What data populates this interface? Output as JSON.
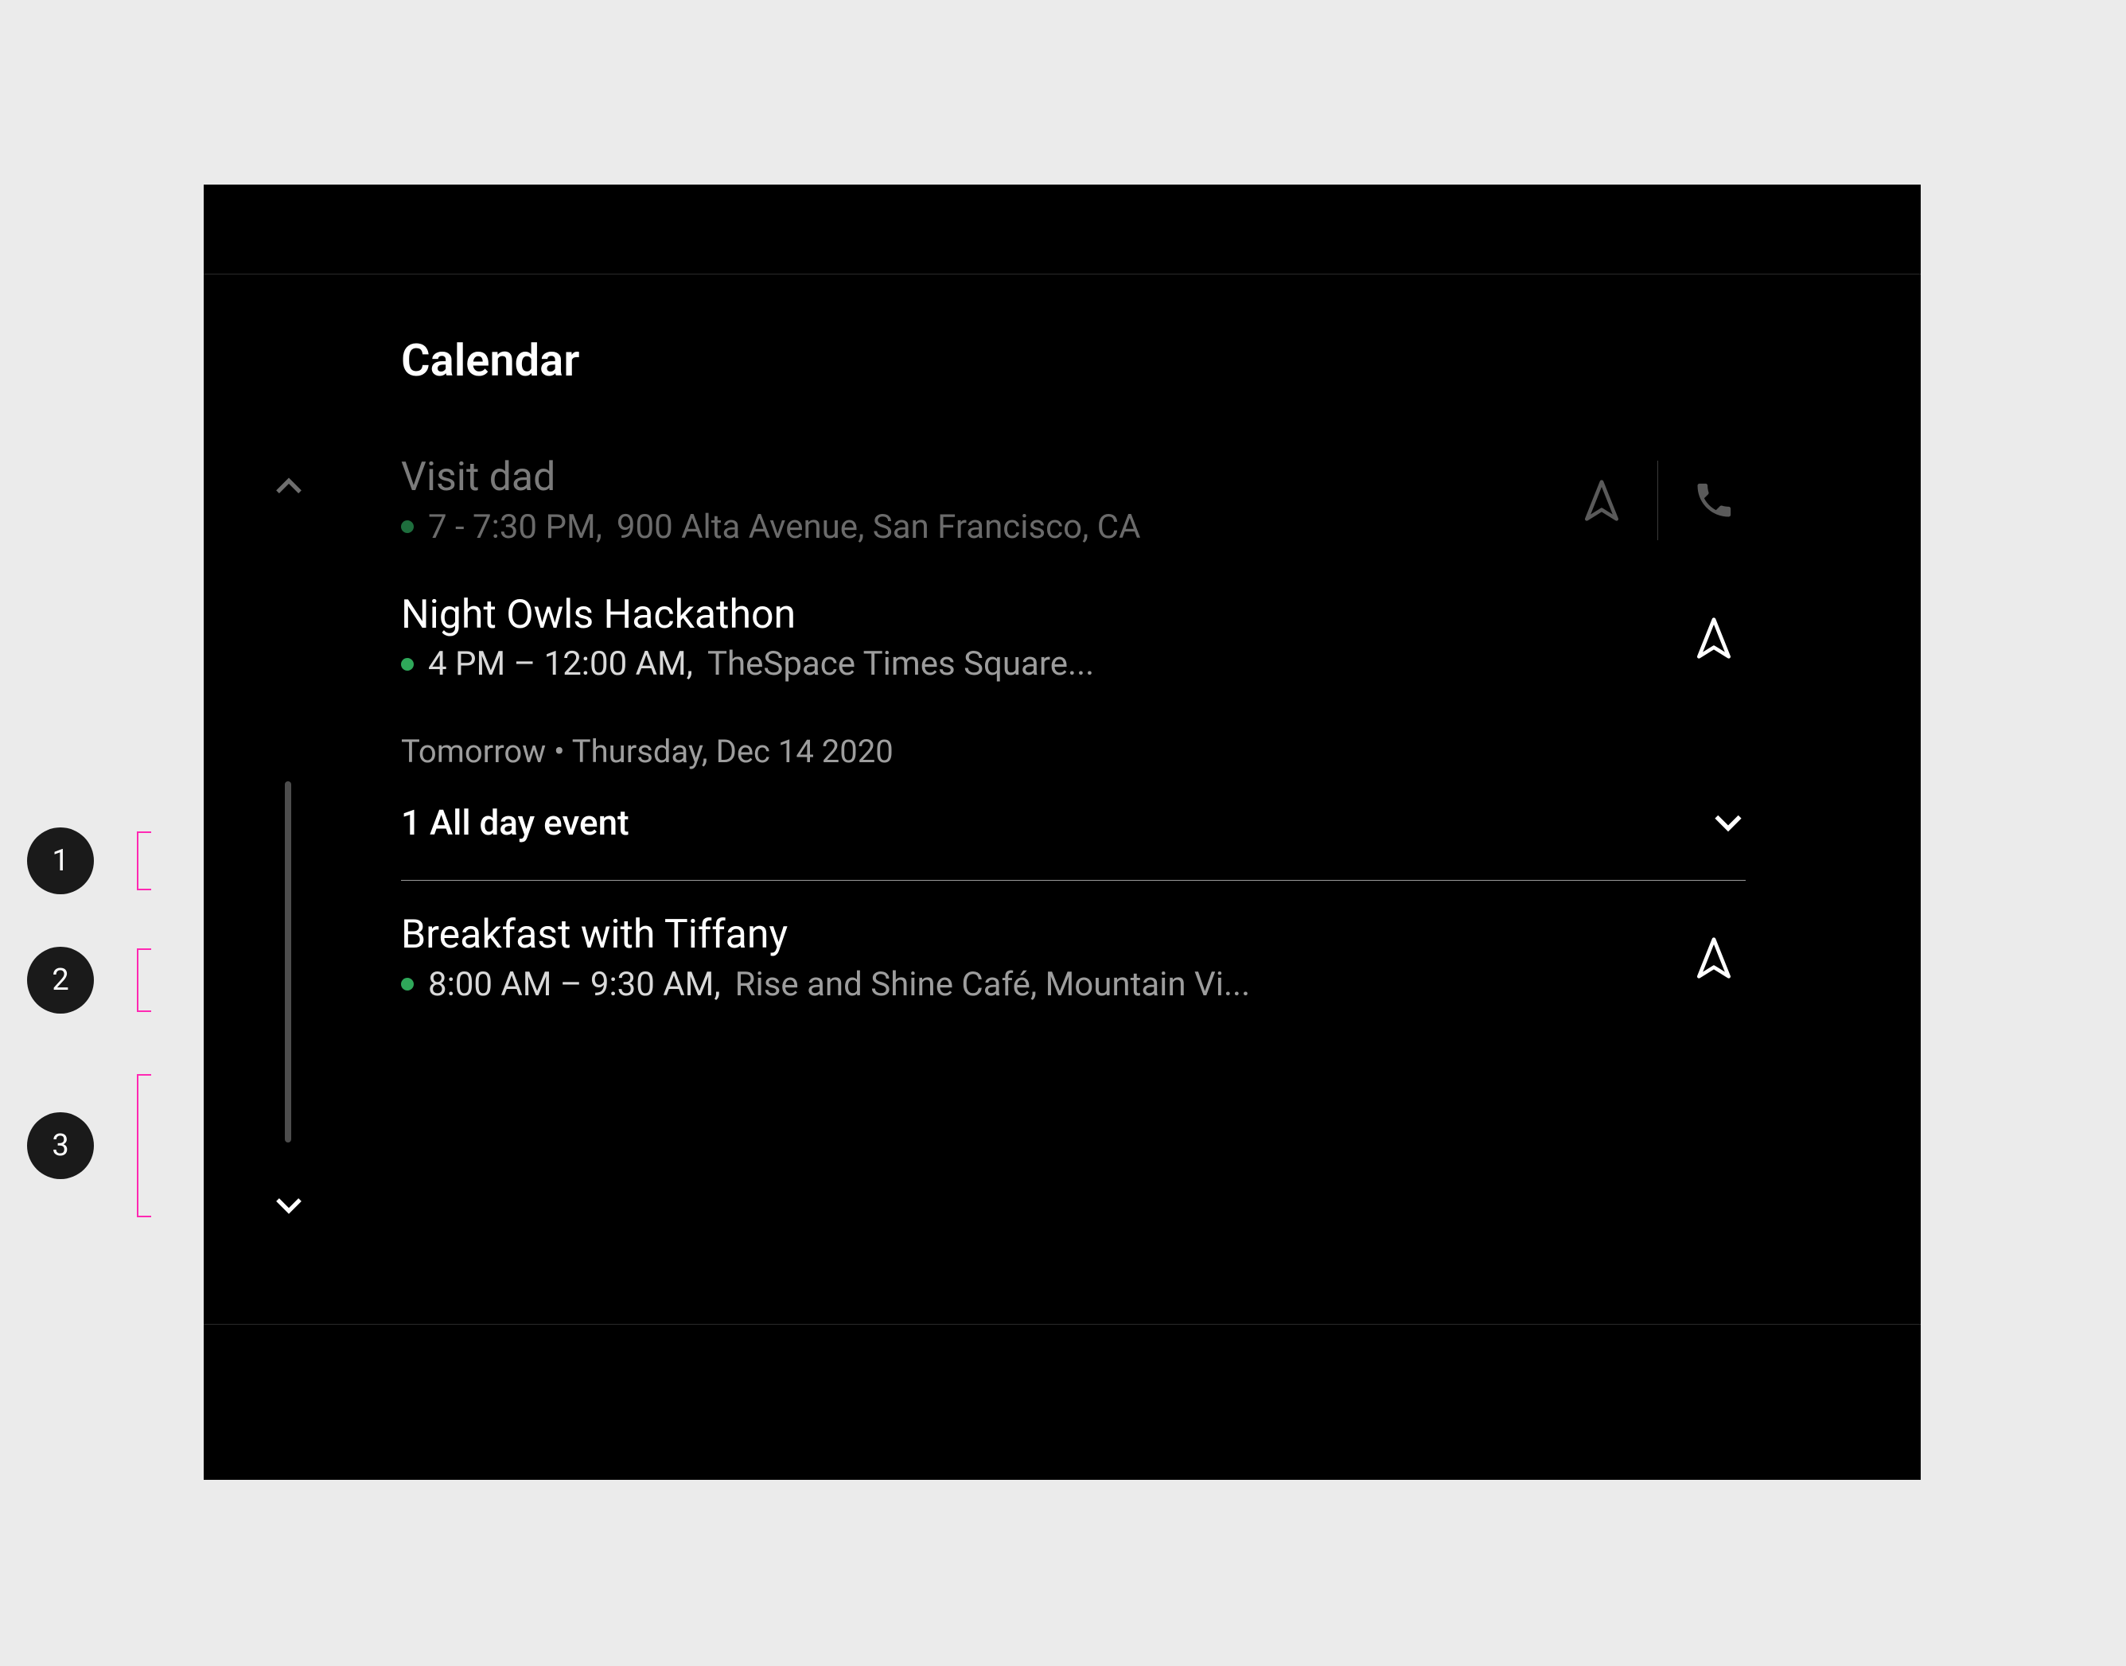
{
  "colors": {
    "accent_green": "#2fa85a",
    "annotation_pink": "#ff29b3"
  },
  "header": {
    "title": "Calendar"
  },
  "events": {
    "past": {
      "title": "Visit dad",
      "time": "7 - 7:30 PM,",
      "location": "900 Alta Avenue, San Francisco, CA"
    },
    "current": {
      "title": "Night Owls Hackathon",
      "time": "4 PM – 12:00 AM,",
      "location": "TheSpace Times Square..."
    },
    "section_header": "Tomorrow • Thursday, Dec 14 2020",
    "allday": {
      "label": "1 All day event"
    },
    "next": {
      "title": "Breakfast with Tiffany",
      "time": "8:00 AM – 9:30 AM,",
      "location": "Rise and Shine Café, Mountain Vi..."
    }
  },
  "annotations": {
    "a1": "1",
    "a2": "2",
    "a3": "3"
  }
}
